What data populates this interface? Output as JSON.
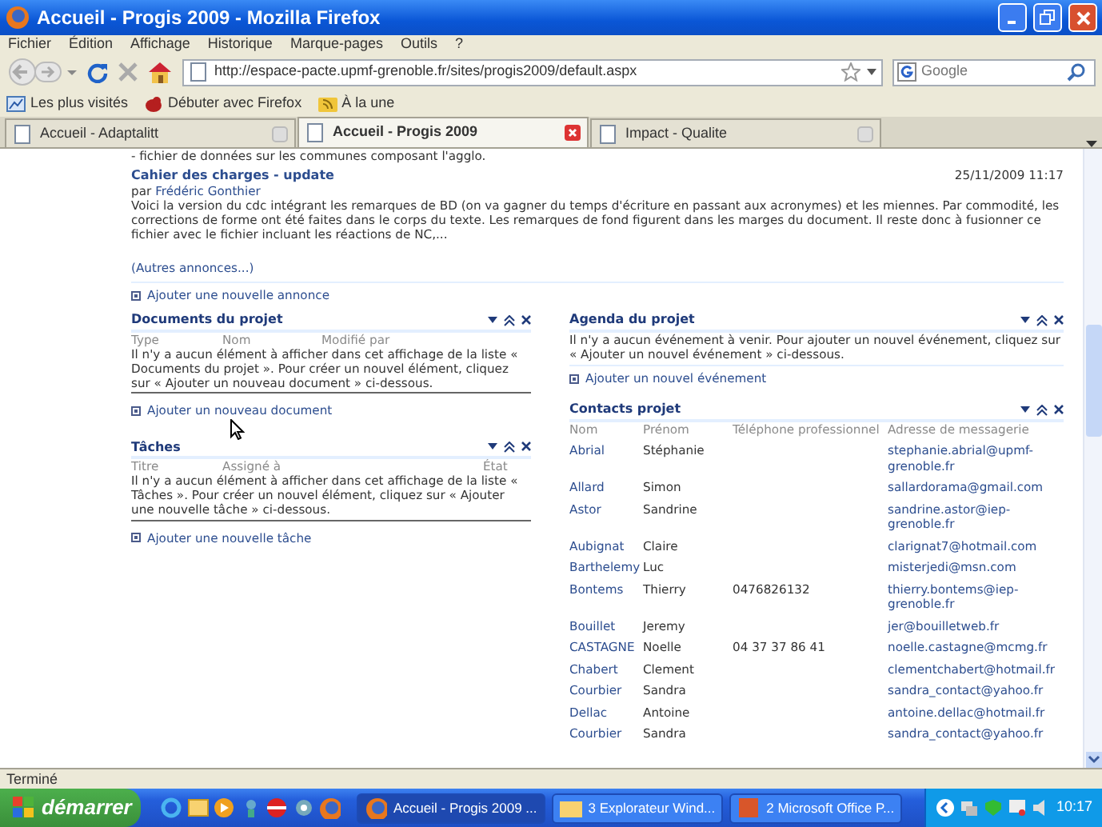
{
  "window": {
    "title": "Accueil - Progis 2009 - Mozilla Firefox"
  },
  "menu": [
    "Fichier",
    "Édition",
    "Affichage",
    "Historique",
    "Marque-pages",
    "Outils",
    "?"
  ],
  "address": {
    "url": "http://espace-pacte.upmf-grenoble.fr/sites/progis2009/default.aspx"
  },
  "search": {
    "placeholder": "Google"
  },
  "bookmarks": [
    "Les plus visités",
    "Débuter avec Firefox",
    "À la une"
  ],
  "tabs": [
    {
      "label": "Accueil - Adaptalitt",
      "selected": false
    },
    {
      "label": "Accueil - Progis 2009",
      "selected": true
    },
    {
      "label": "Impact - Qualite",
      "selected": false
    }
  ],
  "announcements": {
    "cut_line": "- fichier de données sur les communes composant l'agglo.",
    "item": {
      "title": "Cahier des charges - update",
      "author_prefix": "par",
      "author": "Frédéric Gonthier",
      "date": "25/11/2009 11:17",
      "body": "Voici la version du cdc intégrant les remarques de BD (on va gagner du temps d'écriture en passant aux acronymes) et les miennes. Par commodité, les corrections de forme ont été faites dans le corps du texte. Les remarques de fond figurent dans les marges du document. Il reste donc à fusionner ce fichier avec le fichier incluant les réactions de NC,..."
    },
    "more_link": "(Autres annonces...)",
    "add_link": "Ajouter une nouvelle annonce"
  },
  "documents": {
    "title": "Documents du projet",
    "columns": [
      "Type",
      "Nom",
      "Modifié par"
    ],
    "message": "Il n'y a aucun élément à afficher dans cet affichage de la liste « Documents du projet ». Pour créer un nouvel élément, cliquez sur « Ajouter un nouveau document » ci-dessous.",
    "add_link": "Ajouter un nouveau document"
  },
  "tasks": {
    "title": "Tâches",
    "columns": [
      "Titre",
      "Assigné à",
      "État"
    ],
    "message": "Il n'y a aucun élément à afficher dans cet affichage de la liste « Tâches ». Pour créer un nouvel élément, cliquez sur « Ajouter une nouvelle tâche » ci-dessous.",
    "add_link": "Ajouter une nouvelle tâche"
  },
  "agenda": {
    "title": "Agenda du projet",
    "message": "Il n'y a aucun événement à venir. Pour ajouter un nouvel événement, cliquez sur « Ajouter un nouvel événement » ci-dessous.",
    "add_link": "Ajouter un nouvel événement"
  },
  "contacts": {
    "title": "Contacts projet",
    "columns": [
      "Nom",
      "Prénom",
      "Téléphone professionnel",
      "Adresse de messagerie"
    ],
    "rows": [
      [
        "Abrial",
        "Stéphanie",
        "",
        "stephanie.abrial@upmf-grenoble.fr"
      ],
      [
        "Allard",
        "Simon",
        "",
        "sallardorama@gmail.com"
      ],
      [
        "Astor",
        "Sandrine",
        "",
        "sandrine.astor@iep-grenoble.fr"
      ],
      [
        "Aubignat",
        "Claire",
        "",
        "clarignat7@hotmail.com"
      ],
      [
        "Barthelemy",
        "Luc",
        "",
        "misterjedi@msn.com"
      ],
      [
        "Bontems",
        "Thierry",
        "0476826132",
        "thierry.bontems@iep-grenoble.fr"
      ],
      [
        "Bouillet",
        "Jeremy",
        "",
        "jer@bouilletweb.fr"
      ],
      [
        "CASTAGNE",
        "Noelle",
        "04 37 37 86 41",
        "noelle.castagne@mcmg.fr"
      ],
      [
        "Chabert",
        "Clement",
        "",
        "clementchabert@hotmail.fr"
      ],
      [
        "Courbier",
        "Sandra",
        "",
        "sandra_contact@yahoo.fr"
      ],
      [
        "Dellac",
        "Antoine",
        "",
        "antoine.dellac@hotmail.fr"
      ],
      [
        "Courbier",
        "Sandra",
        "",
        "sandra_contact@yahoo.fr"
      ]
    ]
  },
  "status_bar": {
    "text": "Terminé"
  },
  "taskbar": {
    "start": "démarrer",
    "tasks": [
      {
        "label": "Accueil - Progis 2009 ...",
        "selected": true
      },
      {
        "label": "3 Explorateur Wind...",
        "selected": false
      },
      {
        "label": "2 Microsoft Office P...",
        "selected": false
      }
    ],
    "clock": "10:17"
  }
}
